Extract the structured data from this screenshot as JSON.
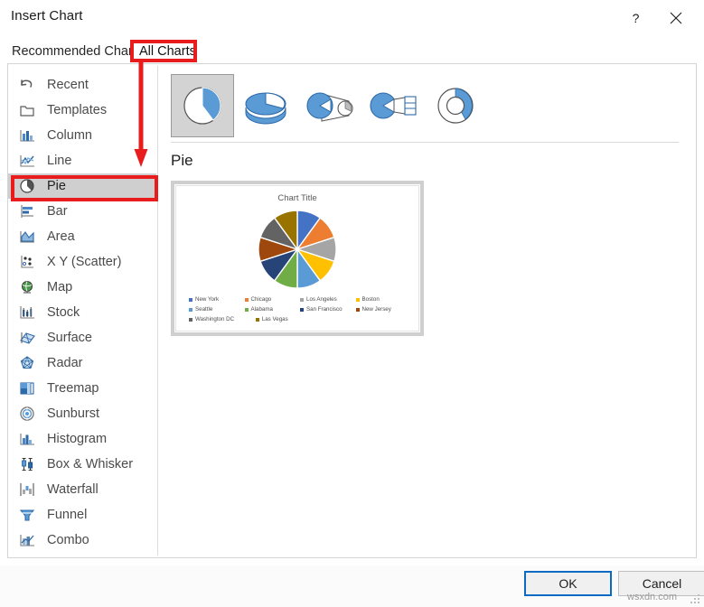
{
  "window": {
    "title": "Insert Chart",
    "help_icon": "question-mark-icon",
    "close_icon": "close-icon"
  },
  "tabs": [
    {
      "label": "Recommended Charts",
      "active": false
    },
    {
      "label": "All Charts",
      "active": true
    }
  ],
  "sidebar": {
    "items": [
      {
        "label": "Recent",
        "icon": "recent-icon",
        "selected": false
      },
      {
        "label": "Templates",
        "icon": "templates-icon",
        "selected": false
      },
      {
        "label": "Column",
        "icon": "column-icon",
        "selected": false
      },
      {
        "label": "Line",
        "icon": "line-icon",
        "selected": false
      },
      {
        "label": "Pie",
        "icon": "pie-icon",
        "selected": true
      },
      {
        "label": "Bar",
        "icon": "bar-icon",
        "selected": false
      },
      {
        "label": "Area",
        "icon": "area-icon",
        "selected": false
      },
      {
        "label": "X Y (Scatter)",
        "icon": "scatter-icon",
        "selected": false
      },
      {
        "label": "Map",
        "icon": "map-icon",
        "selected": false
      },
      {
        "label": "Stock",
        "icon": "stock-icon",
        "selected": false
      },
      {
        "label": "Surface",
        "icon": "surface-icon",
        "selected": false
      },
      {
        "label": "Radar",
        "icon": "radar-icon",
        "selected": false
      },
      {
        "label": "Treemap",
        "icon": "treemap-icon",
        "selected": false
      },
      {
        "label": "Sunburst",
        "icon": "sunburst-icon",
        "selected": false
      },
      {
        "label": "Histogram",
        "icon": "histogram-icon",
        "selected": false
      },
      {
        "label": "Box & Whisker",
        "icon": "box-whisker-icon",
        "selected": false
      },
      {
        "label": "Waterfall",
        "icon": "waterfall-icon",
        "selected": false
      },
      {
        "label": "Funnel",
        "icon": "funnel-icon",
        "selected": false
      },
      {
        "label": "Combo",
        "icon": "combo-icon",
        "selected": false
      }
    ]
  },
  "gallery": {
    "items": [
      {
        "name": "pie-chart-type",
        "selected": true
      },
      {
        "name": "pie-3d-chart-type",
        "selected": false
      },
      {
        "name": "pie-of-pie-chart-type",
        "selected": false
      },
      {
        "name": "bar-of-pie-chart-type",
        "selected": false
      },
      {
        "name": "doughnut-chart-type",
        "selected": false
      }
    ]
  },
  "preview": {
    "type_name": "Pie",
    "chart_title": "Chart Title"
  },
  "chart_data": {
    "type": "pie",
    "title": "Chart Title",
    "xlabel": "",
    "ylabel": "",
    "legend_position": "bottom",
    "grid": false,
    "categories": [
      "New York",
      "Chicago",
      "Los Angeles",
      "Boston",
      "Seattle",
      "Alabama",
      "San Francisco",
      "New Jersey",
      "Washington DC",
      "Las Vegas"
    ],
    "values": [
      10,
      10,
      10,
      10,
      10,
      10,
      10,
      10,
      10,
      10
    ],
    "colors": [
      "#4472c4",
      "#ed7d31",
      "#a5a5a5",
      "#ffc000",
      "#5b9bd5",
      "#70ad47",
      "#264478",
      "#9e480e",
      "#636363",
      "#997300"
    ]
  },
  "footer": {
    "ok_label": "OK",
    "cancel_label": "Cancel",
    "watermark": "wsxdn.com"
  },
  "annotations": {
    "tab_highlight": "All Charts",
    "item_highlight": "Pie",
    "arrow": "red-down-arrow",
    "color": "#e81c1c"
  }
}
